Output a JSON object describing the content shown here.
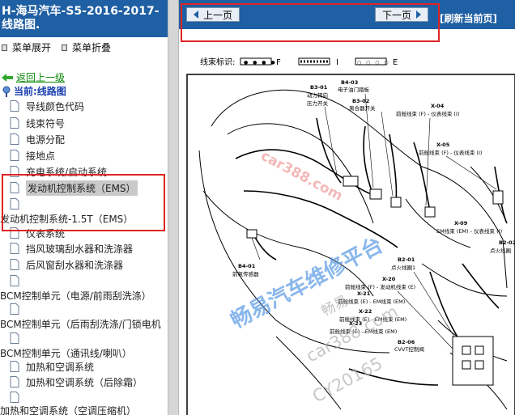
{
  "left_panel": {
    "title": "H-海马汽车-S5-2016-2017- 线路图.",
    "expand_all": "菜单展开",
    "collapse_all": "菜单折叠",
    "back": "返回上一级",
    "current": "当前:线路图",
    "items": [
      {
        "label": "导线颜色代码"
      },
      {
        "label": "线束符号"
      },
      {
        "label": "电源分配"
      },
      {
        "label": "接地点"
      },
      {
        "label": "充电系统/启动系统"
      },
      {
        "label": "发动机控制系统（EMS）"
      },
      {
        "label": ""
      },
      {
        "label": "仪表系统"
      },
      {
        "label": "挡风玻璃刮水器和洗涤器"
      },
      {
        "label": "后风窗刮水器和洗涤器"
      },
      {
        "label": ""
      },
      {
        "label": ""
      },
      {
        "label": ""
      },
      {
        "label": "加热和空调系统"
      },
      {
        "label": "加热和空调系统（后除霜）"
      },
      {
        "label": ""
      }
    ],
    "overflow_lines": [
      "发动机控制系统-1.5T（EMS）",
      "BCM控制单元（电源/前雨刮洗涤）",
      "BCM控制单元（后雨刮洗涤/门锁电机",
      "BCM控制单元（通讯线/喇叭）",
      "加热和空调系统（空调压缩机）"
    ]
  },
  "right_panel": {
    "prev_label": "上一页",
    "next_label": "下一页",
    "refresh_label": "[刷新当前页]",
    "legend_label": "线束标识:",
    "legend_items": [
      "F",
      "I",
      "E"
    ],
    "callouts": [
      {
        "code": "B3-01",
        "name": "动力转向\n压力开关"
      },
      {
        "code": "B4-03",
        "name": "电子油门踏板"
      },
      {
        "code": "B3-02",
        "name": "离合器开关"
      },
      {
        "code": "X-04",
        "name": "前舱线束 (F) - 仪表线束 (I)"
      },
      {
        "code": "X-05",
        "name": "前舱线束 (F) - 仪表线束 (I)"
      },
      {
        "code": "B4-01",
        "name": "前氧传感器"
      },
      {
        "code": "B2-01",
        "name": "点火线圈1"
      },
      {
        "code": "X-09",
        "name": "EM线束 (EM) - 仪表线束 (I)"
      },
      {
        "code": "B2-02",
        "name": "点火线圈"
      },
      {
        "code": "X-20",
        "name": "前舱线束 (F) - 发动机线束 (E)"
      },
      {
        "code": "X-21",
        "name": "前舱线束 (E) - EM线束 (EM)"
      },
      {
        "code": "X-22",
        "name": "前舱线束 (E) - EM线束 (EM)"
      },
      {
        "code": "X-23",
        "name": "前舱线束 (E) - EM线束 (EM)"
      },
      {
        "code": "B2-06",
        "name": "CVVT控制阀"
      }
    ],
    "watermarks": [
      "car388.com",
      "畅易汽车维修平台",
      "畅易",
      "car388.com",
      "CY20165"
    ]
  },
  "colors": {
    "title_bar": "#1f5fa3",
    "highlight_box": "#e02424",
    "back_link": "#0a8a0a",
    "current": "#1a3fb0"
  }
}
